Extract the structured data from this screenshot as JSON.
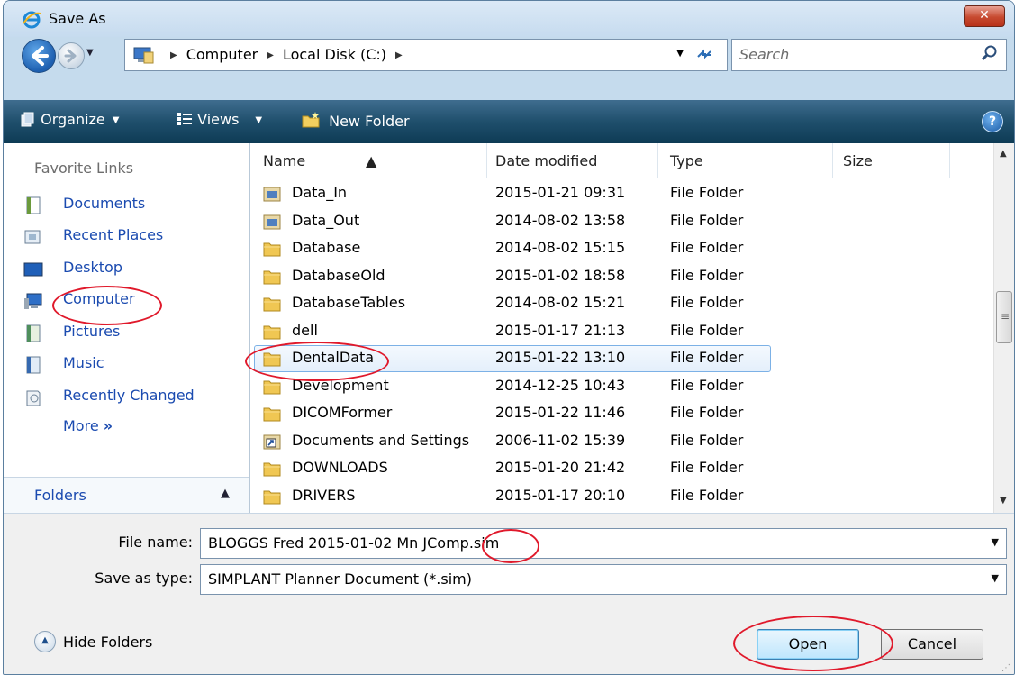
{
  "window": {
    "title": "Save As",
    "close_label": "✕"
  },
  "address": {
    "crumbs": [
      "Computer",
      "Local Disk (C:)"
    ],
    "search_placeholder": "Search"
  },
  "toolbar": {
    "organize": "Organize",
    "views": "Views",
    "new_folder": "New Folder",
    "help": "?"
  },
  "nav": {
    "favorites_header": "Favorite Links",
    "items": [
      {
        "label": "Documents",
        "icon": "documents-icon"
      },
      {
        "label": "Recent Places",
        "icon": "recent-places-icon"
      },
      {
        "label": "Desktop",
        "icon": "desktop-icon"
      },
      {
        "label": "Computer",
        "icon": "computer-icon"
      },
      {
        "label": "Pictures",
        "icon": "pictures-icon"
      },
      {
        "label": "Music",
        "icon": "music-icon"
      },
      {
        "label": "Recently Changed",
        "icon": "recently-changed-icon"
      }
    ],
    "more": "More",
    "more_glyph": "»",
    "folders": "Folders"
  },
  "columns": {
    "name": "Name",
    "date": "Date modified",
    "type": "Type",
    "size": "Size"
  },
  "files": [
    {
      "name": "Data_In",
      "date": "2015-01-21 09:31",
      "type": "File Folder",
      "icon": "special-folder-icon"
    },
    {
      "name": "Data_Out",
      "date": "2014-08-02 13:58",
      "type": "File Folder",
      "icon": "special-folder-icon"
    },
    {
      "name": "Database",
      "date": "2014-08-02 15:15",
      "type": "File Folder",
      "icon": "folder-icon"
    },
    {
      "name": "DatabaseOld",
      "date": "2015-01-02 18:58",
      "type": "File Folder",
      "icon": "folder-icon"
    },
    {
      "name": "DatabaseTables",
      "date": "2014-08-02 15:21",
      "type": "File Folder",
      "icon": "folder-icon"
    },
    {
      "name": "dell",
      "date": "2015-01-17 21:13",
      "type": "File Folder",
      "icon": "folder-icon"
    },
    {
      "name": "DentalData",
      "date": "2015-01-22 13:10",
      "type": "File Folder",
      "icon": "folder-icon",
      "selected": true
    },
    {
      "name": "Development",
      "date": "2014-12-25 10:43",
      "type": "File Folder",
      "icon": "folder-icon"
    },
    {
      "name": "DICOMFormer",
      "date": "2015-01-22 11:46",
      "type": "File Folder",
      "icon": "folder-icon"
    },
    {
      "name": "Documents and Settings",
      "date": "2006-11-02 15:39",
      "type": "File Folder",
      "icon": "shortcut-folder-icon"
    },
    {
      "name": "DOWNLOADS",
      "date": "2015-01-20 21:42",
      "type": "File Folder",
      "icon": "folder-icon"
    },
    {
      "name": "DRIVERS",
      "date": "2015-01-17 20:10",
      "type": "File Folder",
      "icon": "folder-icon"
    }
  ],
  "form": {
    "file_name_label": "File name:",
    "file_name_value": "BLOGGS Fred 2015-01-02 Mn JComp.sim",
    "save_type_label": "Save as type:",
    "save_type_value": "SIMPLANT Planner Document (*.sim)"
  },
  "footer": {
    "hide_folders": "Hide Folders",
    "open": "Open",
    "cancel": "Cancel"
  },
  "colors": {
    "annotation": "#e0192b",
    "link": "#1b4bb0",
    "toolbar": "#1f4f6c"
  }
}
